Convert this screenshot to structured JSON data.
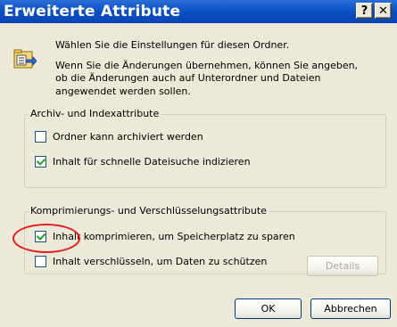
{
  "window": {
    "title": "Erweiterte Attribute",
    "help_label": "?",
    "close_label": "✕"
  },
  "intro": {
    "line1": "Wählen Sie die Einstellungen für diesen Ordner.",
    "line2": "Wenn Sie die Änderungen übernehmen, können Sie angeben,",
    "line3": "ob die Änderungen auch auf Unterordner und Dateien",
    "line4": "angewendet werden sollen."
  },
  "archive_group": {
    "label": "Archiv- und Indexattribute",
    "archive": {
      "label": "Ordner kann archiviert werden",
      "checked": false
    },
    "index": {
      "label": "Inhalt für schnelle Dateisuche indizieren",
      "checked": true
    }
  },
  "compress_group": {
    "label": "Komprimierungs- und Verschlüsselungsattribute",
    "compress": {
      "label": "Inhalt komprimieren, um Speicherplatz zu sparen",
      "checked": true
    },
    "encrypt": {
      "label": "Inhalt verschlüsseln, um Daten zu schützen",
      "checked": false
    },
    "details_label": "Details"
  },
  "buttons": {
    "ok": "OK",
    "cancel": "Abbrechen"
  },
  "colors": {
    "titlebar": "#0a4fc4",
    "face": "#ece9d8",
    "highlight": "#e41e1e"
  }
}
